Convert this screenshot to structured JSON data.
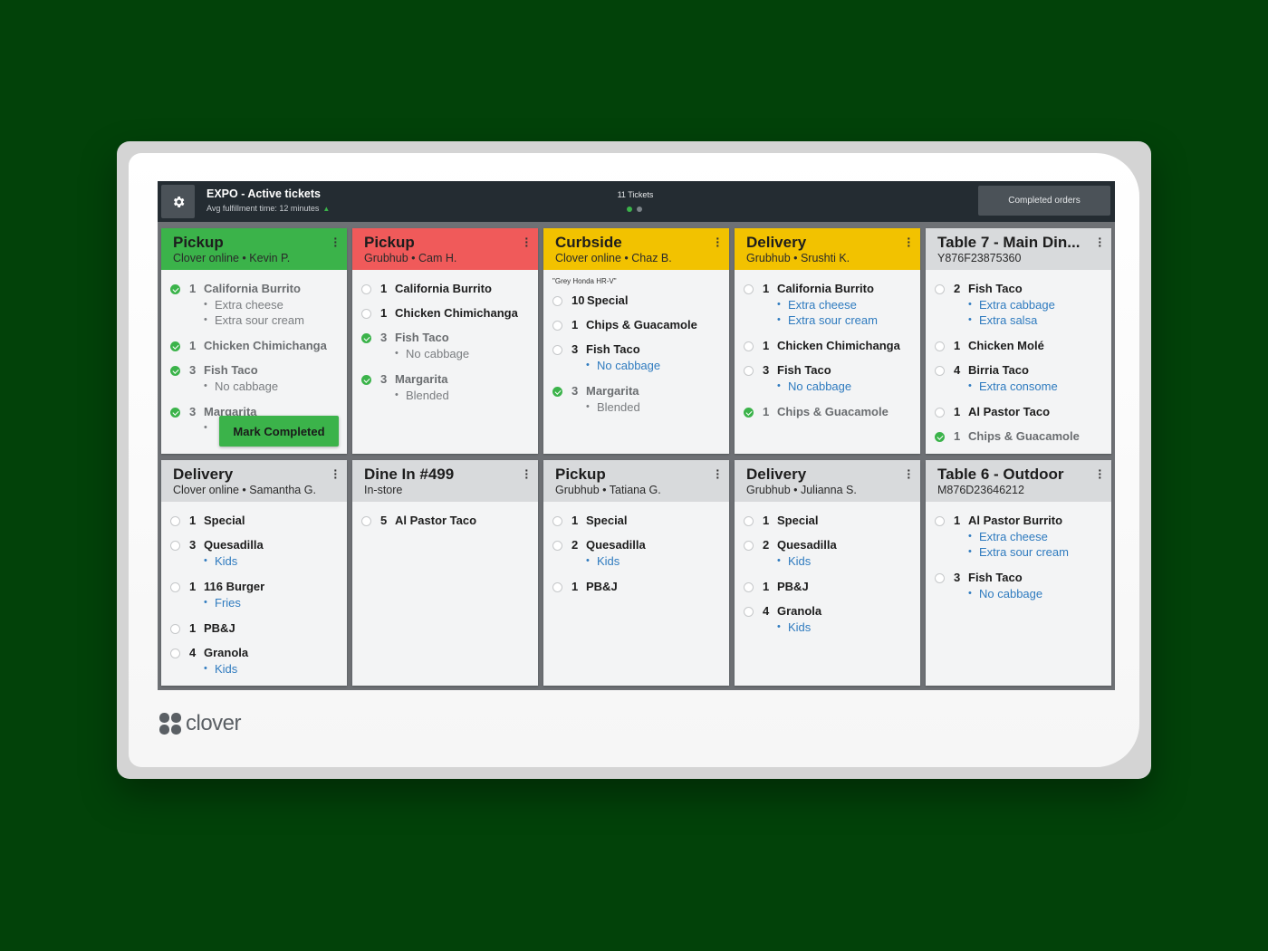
{
  "header": {
    "title": "EXPO - Active tickets",
    "avg_text": "Avg fulfillment time: 12 minutes",
    "avg_trend_icon": "up-triangle-icon",
    "tickets_count": "11 Tickets",
    "completed_orders_label": "Completed orders",
    "settings_icon": "gear-icon"
  },
  "brand": {
    "name": "clover"
  },
  "colors": {
    "green": "#3bb34a",
    "red": "#f05a5a",
    "yellow": "#f2c200",
    "gray": "#d8dadc",
    "link_blue": "#2f7bbf"
  },
  "cards": [
    {
      "title": "Pickup",
      "subtitle": "Clover online •  Kevin P.",
      "color": "green",
      "mark_completed_label": "Mark Completed",
      "items": [
        {
          "qty": "1",
          "name": "California Burrito",
          "done": true,
          "mods": [
            "Extra cheese",
            "Extra sour cream"
          ]
        },
        {
          "qty": "1",
          "name": "Chicken Chimichanga",
          "done": true,
          "mods": []
        },
        {
          "qty": "3",
          "name": "Fish Taco",
          "done": true,
          "mods": [
            "No cabbage"
          ]
        },
        {
          "qty": "3",
          "name": "Margarita",
          "done": true,
          "mods": [
            ""
          ]
        }
      ]
    },
    {
      "title": "Pickup",
      "subtitle": "Grubhub •  Cam H.",
      "color": "red",
      "items": [
        {
          "qty": "1",
          "name": "California Burrito",
          "done": false,
          "mods": []
        },
        {
          "qty": "1",
          "name": "Chicken Chimichanga",
          "done": false,
          "mods": []
        },
        {
          "qty": "3",
          "name": "Fish Taco",
          "done": true,
          "mods": [
            "No cabbage"
          ]
        },
        {
          "qty": "3",
          "name": "Margarita",
          "done": true,
          "mods": [
            "Blended"
          ]
        }
      ]
    },
    {
      "title": "Curbside",
      "subtitle": "Clover online •  Chaz B.",
      "color": "yellow",
      "note": "\"Grey Honda HR-V\"",
      "items": [
        {
          "qty": "10",
          "name": "Special",
          "done": false,
          "mods": []
        },
        {
          "qty": "1",
          "name": "Chips & Guacamole",
          "done": false,
          "mods": []
        },
        {
          "qty": "3",
          "name": "Fish Taco",
          "done": false,
          "mods": [
            "No cabbage"
          ]
        },
        {
          "qty": "3",
          "name": "Margarita",
          "done": true,
          "mods": [
            "Blended"
          ]
        }
      ]
    },
    {
      "title": "Delivery",
      "subtitle": "Grubhub •  Srushti K.",
      "color": "yellow",
      "items": [
        {
          "qty": "1",
          "name": "California Burrito",
          "done": false,
          "mods": [
            "Extra cheese",
            "Extra sour cream"
          ]
        },
        {
          "qty": "1",
          "name": "Chicken Chimichanga",
          "done": false,
          "mods": []
        },
        {
          "qty": "3",
          "name": "Fish Taco",
          "done": false,
          "mods": [
            "No cabbage"
          ]
        },
        {
          "qty": "1",
          "name": "Chips & Guacamole",
          "done": true,
          "mods": []
        }
      ]
    },
    {
      "title": "Table 7 - Main Din...",
      "subtitle": "Y876F23875360",
      "color": "gray",
      "items": [
        {
          "qty": "2",
          "name": "Fish Taco",
          "done": false,
          "mods": [
            "Extra cabbage",
            "Extra salsa"
          ]
        },
        {
          "qty": "1",
          "name": "Chicken Molé",
          "done": false,
          "mods": []
        },
        {
          "qty": "4",
          "name": "Birria Taco",
          "done": false,
          "mods": [
            "Extra consome"
          ]
        },
        {
          "qty": "1",
          "name": "Al Pastor Taco",
          "done": false,
          "mods": []
        },
        {
          "qty": "1",
          "name": "Chips & Guacamole",
          "done": true,
          "mods": []
        }
      ]
    },
    {
      "title": "Delivery",
      "subtitle": "Clover online •  Samantha G.",
      "color": "gray",
      "items": [
        {
          "qty": "1",
          "name": "Special",
          "done": false,
          "mods": []
        },
        {
          "qty": "3",
          "name": "Quesadilla",
          "done": false,
          "mods": [
            "Kids"
          ]
        },
        {
          "qty": "1",
          "name": "116 Burger",
          "done": false,
          "mods": [
            "Fries"
          ]
        },
        {
          "qty": "1",
          "name": "PB&J",
          "done": false,
          "mods": []
        },
        {
          "qty": "4",
          "name": "Granola",
          "done": false,
          "mods": [
            "Kids"
          ]
        }
      ]
    },
    {
      "title": "Dine In #499",
      "subtitle": "In-store",
      "color": "gray",
      "items": [
        {
          "qty": "5",
          "name": "Al Pastor Taco",
          "done": false,
          "mods": []
        }
      ]
    },
    {
      "title": "Pickup",
      "subtitle": "Grubhub •  Tatiana G.",
      "color": "gray",
      "items": [
        {
          "qty": "1",
          "name": "Special",
          "done": false,
          "mods": []
        },
        {
          "qty": "2",
          "name": "Quesadilla",
          "done": false,
          "mods": [
            "Kids"
          ]
        },
        {
          "qty": "1",
          "name": "PB&J",
          "done": false,
          "mods": []
        }
      ]
    },
    {
      "title": "Delivery",
      "subtitle": "Grubhub •  Julianna S.",
      "color": "gray",
      "items": [
        {
          "qty": "1",
          "name": "Special",
          "done": false,
          "mods": []
        },
        {
          "qty": "2",
          "name": "Quesadilla",
          "done": false,
          "mods": [
            "Kids"
          ]
        },
        {
          "qty": "1",
          "name": "PB&J",
          "done": false,
          "mods": []
        },
        {
          "qty": "4",
          "name": "Granola",
          "done": false,
          "mods": [
            "Kids"
          ]
        }
      ]
    },
    {
      "title": "Table 6 - Outdoor",
      "subtitle": "M876D23646212",
      "color": "gray",
      "items": [
        {
          "qty": "1",
          "name": "Al Pastor Burrito",
          "done": false,
          "mods": [
            "Extra cheese",
            "Extra sour cream"
          ]
        },
        {
          "qty": "3",
          "name": "Fish Taco",
          "done": false,
          "mods": [
            "No cabbage"
          ]
        }
      ]
    }
  ]
}
